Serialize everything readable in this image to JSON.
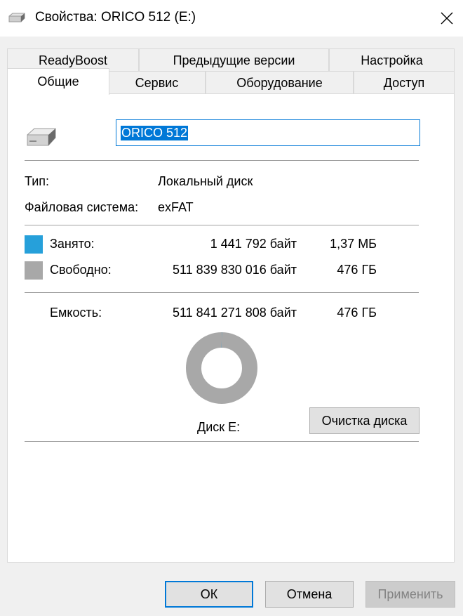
{
  "window": {
    "title": "Свойства: ORICO 512 (E:)",
    "close_glyph": "✕"
  },
  "tabs_row1": [
    "ReadyBoost",
    "Предыдущие версии",
    "Настройка"
  ],
  "tabs_row2": [
    "Общие",
    "Сервис",
    "Оборудование",
    "Доступ"
  ],
  "active_tab": "Общие",
  "general": {
    "volume_name": "ORICO 512",
    "type_label": "Тип:",
    "type_value": "Локальный диск",
    "fs_label": "Файловая система:",
    "fs_value": "exFAT",
    "used_label": "Занято:",
    "used_bytes": "1 441 792 байт",
    "used_size": "1,37 МБ",
    "free_label": "Свободно:",
    "free_bytes": "511 839 830 016 байт",
    "free_size": "476 ГБ",
    "capacity_label": "Емкость:",
    "capacity_bytes": "511 841 271 808 байт",
    "capacity_size": "476 ГБ",
    "disk_label": "Диск E:",
    "cleanup_button": "Очистка диска"
  },
  "usage": {
    "used_fraction": 2.8e-06
  },
  "colors": {
    "used": "#26a0da",
    "free": "#a8a8a8",
    "accent": "#0078d7"
  },
  "buttons": {
    "ok": "ОК",
    "cancel": "Отмена",
    "apply": "Применить"
  }
}
